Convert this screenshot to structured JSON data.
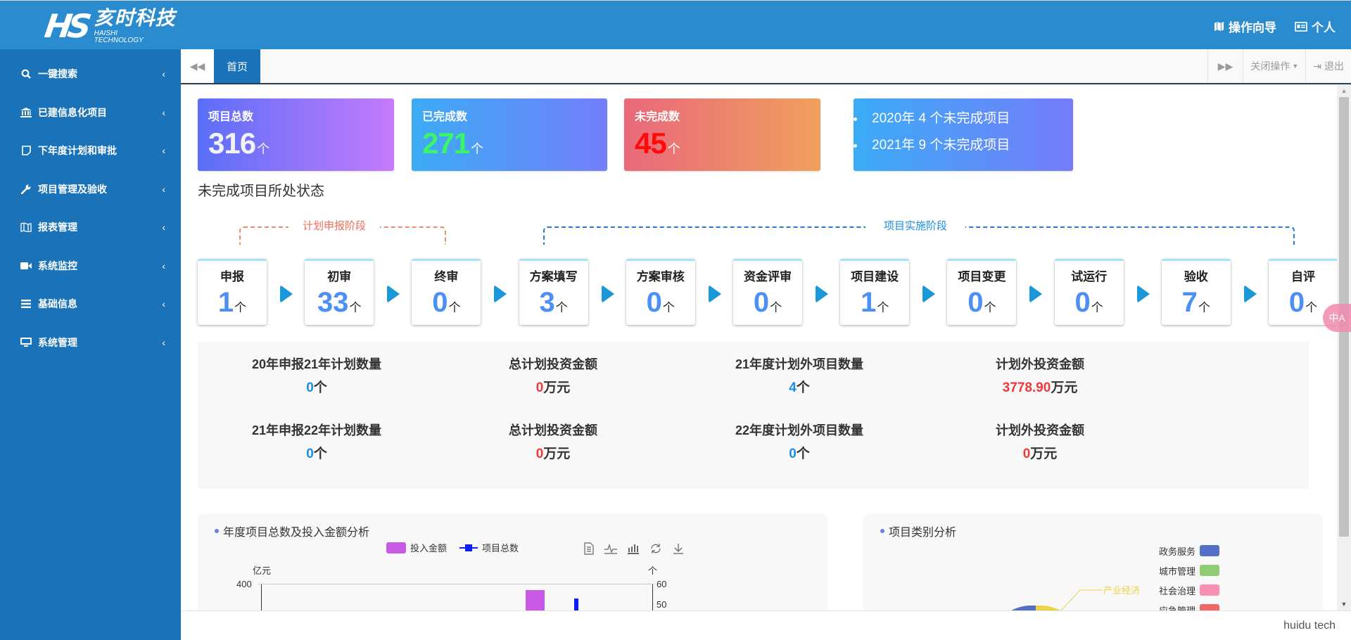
{
  "header": {
    "brand_cn": "亥时科技",
    "brand_en_1": "HAISHI",
    "brand_en_2": "TECHNOLOGY",
    "logo_mark": "HS",
    "guide_label": "操作向导",
    "profile_label": "个人"
  },
  "sidebar": {
    "items": [
      {
        "label": "一键搜索",
        "icon": "search-icon"
      },
      {
        "label": "已建信息化项目",
        "icon": "bank-icon"
      },
      {
        "label": "下年度计划和审批",
        "icon": "note-icon"
      },
      {
        "label": "项目管理及验收",
        "icon": "wrench-icon"
      },
      {
        "label": "报表管理",
        "icon": "map-icon"
      },
      {
        "label": "系统监控",
        "icon": "video-camera-icon"
      },
      {
        "label": "基础信息",
        "icon": "list-icon"
      },
      {
        "label": "系统管理",
        "icon": "monitor-icon"
      }
    ]
  },
  "tabs": {
    "home": "首页",
    "close_ops": "关闭操作",
    "logout": "退出"
  },
  "cards": {
    "total": {
      "title": "项目总数",
      "value": "316",
      "unit": "个"
    },
    "done": {
      "title": "已完成数",
      "value": "271",
      "unit": "个"
    },
    "undone": {
      "title": "未完成数",
      "value": "45",
      "unit": "个"
    },
    "years": [
      "2020年 4 个未完成项目",
      "2021年 9 个未完成项目"
    ]
  },
  "status_section": {
    "title": "未完成项目所处状态",
    "phase_plan": "计划申报阶段",
    "phase_impl": "项目实施阶段",
    "unit": "个",
    "stages": [
      {
        "name": "申报",
        "value": "1"
      },
      {
        "name": "初审",
        "value": "33"
      },
      {
        "name": "终审",
        "value": "0"
      },
      {
        "name": "方案填写",
        "value": "3"
      },
      {
        "name": "方案审核",
        "value": "0"
      },
      {
        "name": "资金评审",
        "value": "0"
      },
      {
        "name": "项目建设",
        "value": "1"
      },
      {
        "name": "项目变更",
        "value": "0"
      },
      {
        "name": "试运行",
        "value": "0"
      },
      {
        "name": "验收",
        "value": "7"
      },
      {
        "name": "自评",
        "value": "0"
      }
    ]
  },
  "stats": [
    {
      "label": "20年申报21年计划数量",
      "value": "0",
      "unit": "个",
      "color": "blue"
    },
    {
      "label": "总计划投资金额",
      "value": "0",
      "unit": "万元",
      "color": "red"
    },
    {
      "label": "21年度计划外项目数量",
      "value": "4",
      "unit": "个",
      "color": "blue"
    },
    {
      "label": "计划外投资金额",
      "value": "3778.90",
      "unit": "万元",
      "color": "red"
    },
    {
      "label": "21年申报22年计划数量",
      "value": "0",
      "unit": "个",
      "color": "blue"
    },
    {
      "label": "总计划投资金额",
      "value": "0",
      "unit": "万元",
      "color": "red"
    },
    {
      "label": "22年度计划外项目数量",
      "value": "0",
      "unit": "个",
      "color": "blue"
    },
    {
      "label": "计划外投资金额",
      "value": "0",
      "unit": "万元",
      "color": "red"
    }
  ],
  "chart_data": [
    {
      "type": "bar",
      "title": "年度项目总数及投入金额分析",
      "legend": [
        "投入金额",
        "项目总数"
      ],
      "series_colors": {
        "投入金额": "#c95ae6",
        "项目总数": "#0a1ef5"
      },
      "ylabel_left": "亿元",
      "ylabel_right": "个",
      "yticks_left": [
        "400"
      ],
      "yticks_right": [
        "60",
        "50"
      ],
      "ylim_left": [
        0,
        400
      ],
      "ylim_right": [
        0,
        60
      ],
      "toolbox": [
        "data-view-icon",
        "line-chart-icon",
        "bar-chart-icon",
        "restore-icon",
        "download-icon"
      ],
      "note": "chart partially visible; only top portion rendered"
    },
    {
      "type": "pie",
      "title": "项目类别分析",
      "legend": [
        {
          "name": "政务服务",
          "color": "#5470c6"
        },
        {
          "name": "城市管理",
          "color": "#91cc75"
        },
        {
          "name": "社会治理",
          "color": "#f690b5"
        },
        {
          "name": "应急管理",
          "color": "#ee6666"
        }
      ],
      "visible_labels": [
        {
          "name": "产业经济",
          "color": "#ead445"
        }
      ]
    }
  ],
  "footer": {
    "text": "huidu tech"
  },
  "float_button": {
    "label": "中A"
  }
}
